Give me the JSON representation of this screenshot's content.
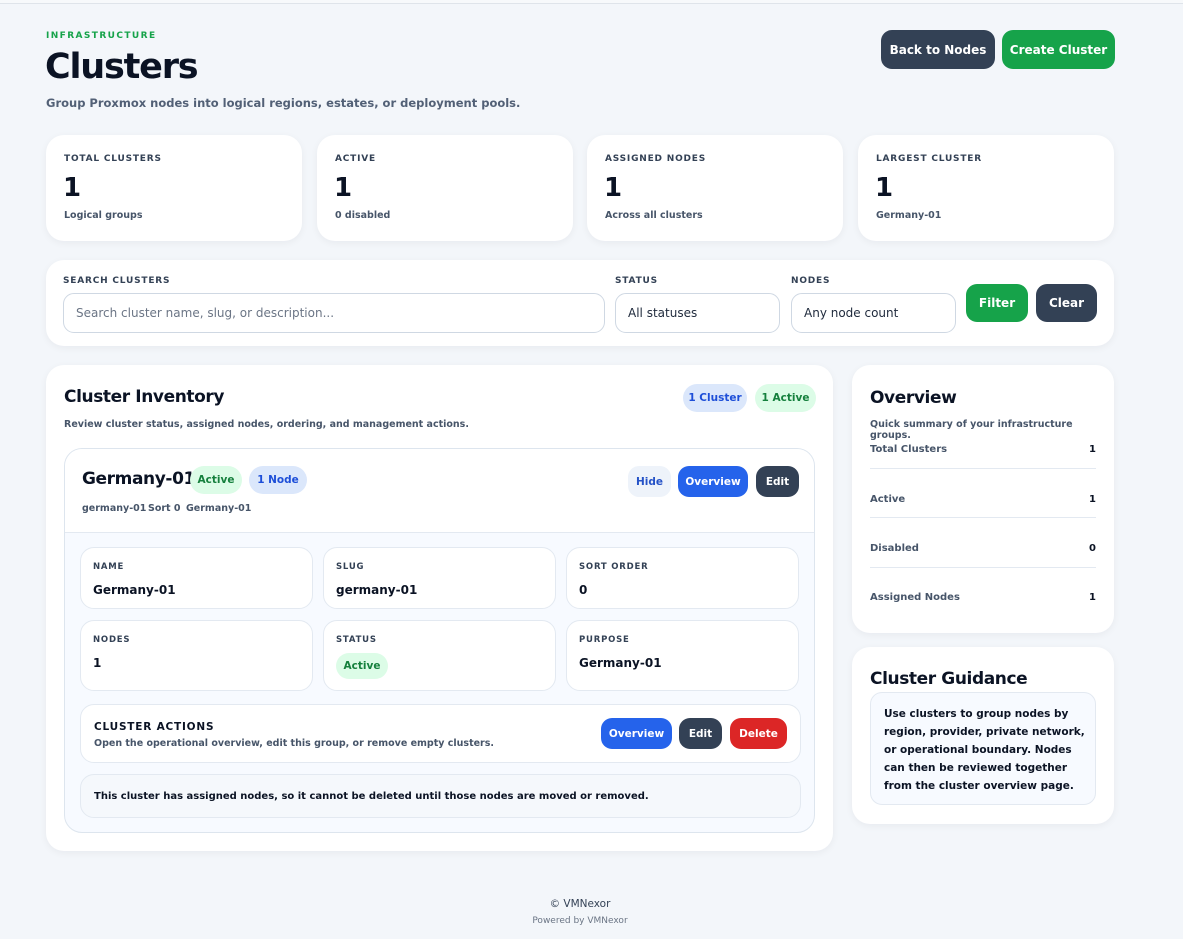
{
  "header": {
    "eyebrow": "INFRASTRUCTURE",
    "title": "Clusters",
    "subtitle": "Group Proxmox nodes into logical regions, estates, or deployment pools.",
    "back_label": "Back to Nodes",
    "create_label": "Create Cluster"
  },
  "stats": [
    {
      "label": "TOTAL CLUSTERS",
      "value": "1",
      "note": "Logical groups"
    },
    {
      "label": "ACTIVE",
      "value": "1",
      "note": "0 disabled"
    },
    {
      "label": "ASSIGNED NODES",
      "value": "1",
      "note": "Across all clusters"
    },
    {
      "label": "LARGEST CLUSTER",
      "value": "1",
      "note": "Germany-01"
    }
  ],
  "filters": {
    "search_label": "SEARCH CLUSTERS",
    "search_placeholder": "Search cluster name, slug, or description...",
    "status_label": "STATUS",
    "status_value": "All statuses",
    "nodes_label": "NODES",
    "nodes_value": "Any node count",
    "filter_label": "Filter",
    "clear_label": "Clear"
  },
  "inventory": {
    "title": "Cluster Inventory",
    "subtitle": "Review cluster status, assigned nodes, ordering, and management actions.",
    "count_pill": "1 Cluster",
    "active_pill": "1 Active",
    "cluster": {
      "name": "Germany-01",
      "status_badge": "Active",
      "nodes_badge": "1 Node",
      "meta_slug": "germany-01",
      "meta_sort": "Sort 0",
      "meta_purpose": "Germany-01",
      "hide_label": "Hide",
      "overview_label": "Overview",
      "edit_label": "Edit",
      "details": {
        "name_label": "NAME",
        "name_value": "Germany-01",
        "slug_label": "SLUG",
        "slug_value": "germany-01",
        "sort_label": "SORT ORDER",
        "sort_value": "0",
        "nodes_label": "NODES",
        "nodes_value": "1",
        "status_label": "STATUS",
        "status_value": "Active",
        "purpose_label": "PURPOSE",
        "purpose_value": "Germany-01"
      },
      "actions": {
        "title": "CLUSTER ACTIONS",
        "subtitle": "Open the operational overview, edit this group, or remove empty clusters.",
        "overview_label": "Overview",
        "edit_label": "Edit",
        "delete_label": "Delete"
      },
      "note": "This cluster has assigned nodes, so it cannot be deleted until those nodes are moved or removed."
    }
  },
  "overview": {
    "title": "Overview",
    "subtitle": "Quick summary of your infrastructure groups.",
    "rows": [
      {
        "label": "Total Clusters",
        "value": "1"
      },
      {
        "label": "Active",
        "value": "1"
      },
      {
        "label": "Disabled",
        "value": "0"
      },
      {
        "label": "Assigned Nodes",
        "value": "1"
      }
    ]
  },
  "guidance": {
    "title": "Cluster Guidance",
    "text": "Use clusters to group nodes by region, provider, private network, or operational boundary. Nodes can then be reviewed together from the cluster overview page."
  },
  "footer": {
    "copyright": "© VMNexor",
    "powered": "Powered by VMNexor"
  },
  "colors": {
    "accent_green": "#16a34a",
    "accent_blue": "#2563eb",
    "danger_red": "#dc2626",
    "dark_button": "#334155"
  }
}
